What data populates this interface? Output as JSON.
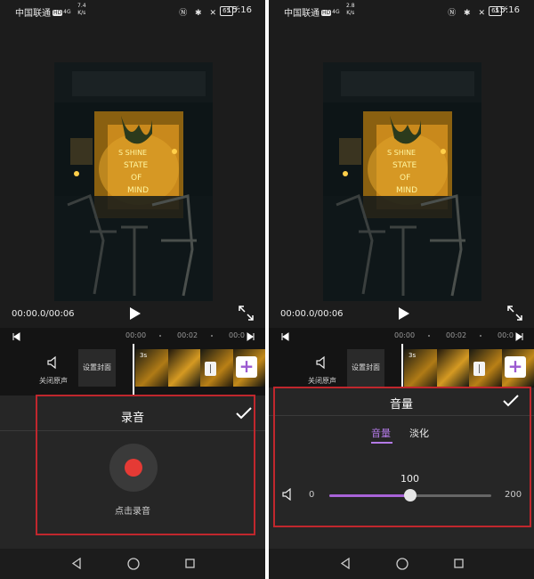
{
  "status_bar": {
    "carrier": "中国联通",
    "hd": "HD",
    "signal": "4G",
    "speed_left_value": "7.4",
    "speed_right_value": "2.8",
    "speed_unit": "K/s",
    "battery": "65",
    "time": "15:16"
  },
  "player": {
    "timecode": "00:00.0/00:06"
  },
  "timeline": {
    "ticks": [
      "00:00",
      "00:02",
      "00:0"
    ],
    "mute_label": "关闭原声",
    "cover_label": "设置封面",
    "clip_duration": "3s",
    "add_label": "+"
  },
  "record_panel": {
    "title": "录音",
    "record_label": "点击录音"
  },
  "volume_panel": {
    "title": "音量",
    "tabs": [
      {
        "label": "音量",
        "active": true
      },
      {
        "label": "淡化",
        "active": false
      }
    ],
    "min": "0",
    "max": "200",
    "value": "100",
    "value_fraction": 0.5
  },
  "colors": {
    "accent": "#a863d8",
    "record": "#e53a35",
    "highlight": "#c0272d"
  },
  "icons": [
    "play-icon",
    "expand-icon",
    "skip-start-icon",
    "skip-end-icon",
    "speaker-icon",
    "check-icon",
    "record-icon",
    "back-icon",
    "home-icon",
    "recent-icon"
  ]
}
